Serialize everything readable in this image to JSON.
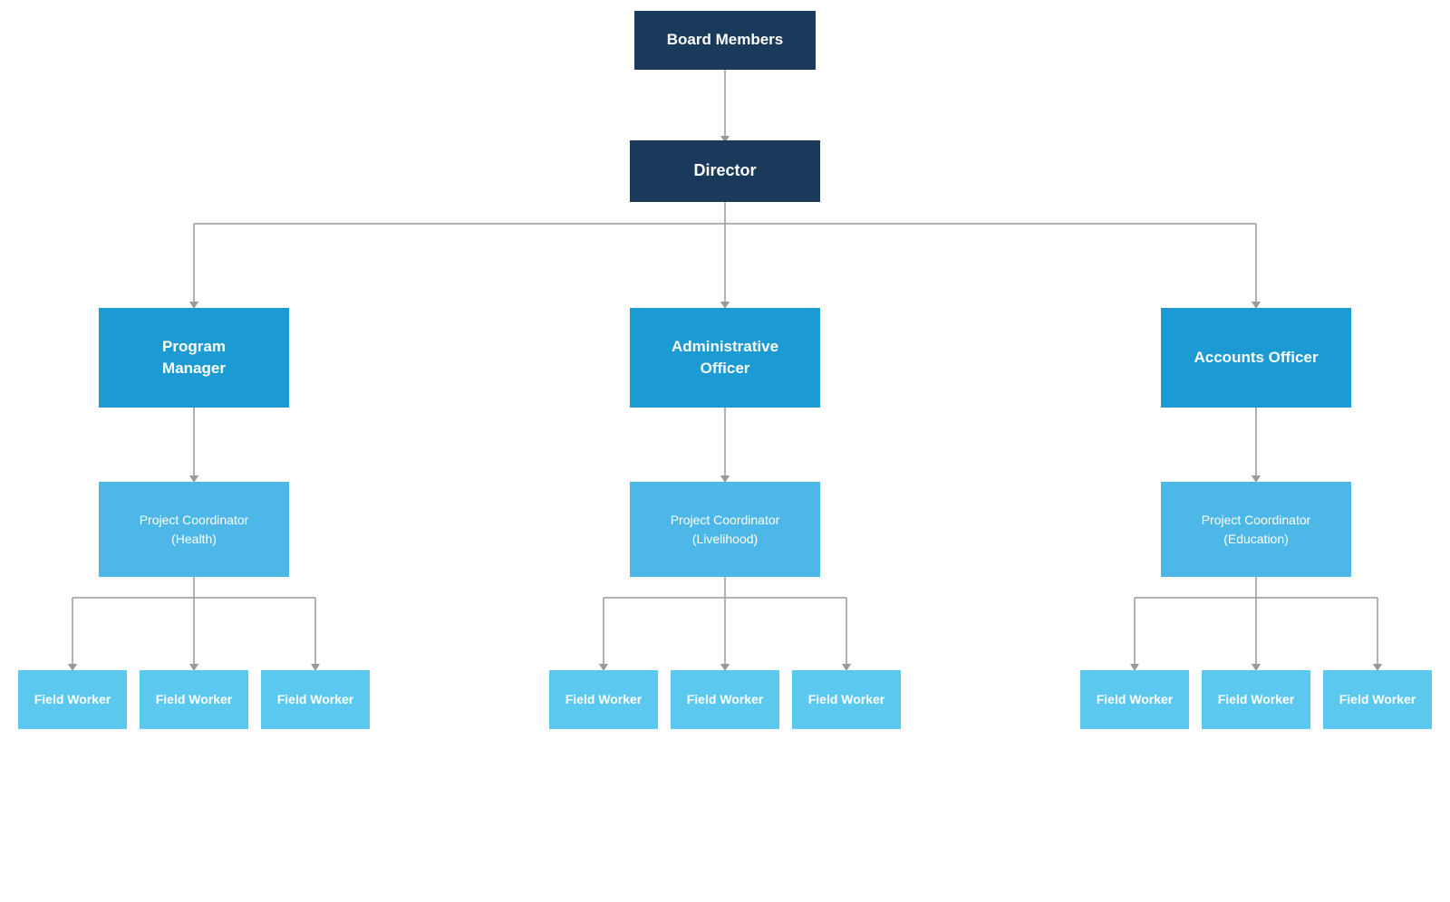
{
  "nodes": {
    "board_members": {
      "label": "Board Members"
    },
    "director": {
      "label": "Director"
    },
    "program_manager": {
      "label": "Program\nManager"
    },
    "admin_officer": {
      "label": "Administrative\nOfficer"
    },
    "accounts_officer": {
      "label": "Accounts Officer"
    },
    "pc_health": {
      "label": "Project Coordinator\n(Health)"
    },
    "pc_livelihood": {
      "label": "Project Coordinator\n(Livelihood)"
    },
    "pc_education": {
      "label": "Project Coordinator\n(Education)"
    },
    "fw_h1": {
      "label": "Field Worker"
    },
    "fw_h2": {
      "label": "Field Worker"
    },
    "fw_h3": {
      "label": "Field Worker"
    },
    "fw_l1": {
      "label": "Field Worker"
    },
    "fw_l2": {
      "label": "Field Worker"
    },
    "fw_l3": {
      "label": "Field Worker"
    },
    "fw_e1": {
      "label": "Field Worker"
    },
    "fw_e2": {
      "label": "Field Worker"
    },
    "fw_e3": {
      "label": "Field Worker"
    }
  },
  "colors": {
    "dark": "#1a3a5c",
    "medium": "#1b9ad4",
    "light": "#4db8e8",
    "field": "#5bc8f0",
    "connector": "#999999",
    "bg": "#ffffff"
  }
}
